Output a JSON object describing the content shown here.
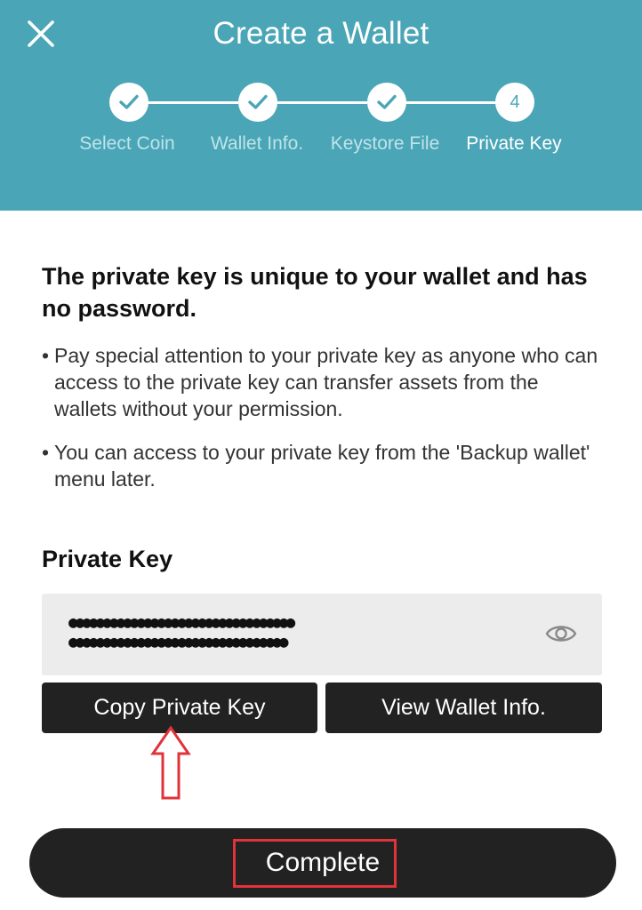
{
  "header": {
    "title": "Create a Wallet",
    "close_icon": "close-icon",
    "background": "#4aa6b6"
  },
  "steps": [
    {
      "label": "Select Coin",
      "state": "done",
      "marker": "check-icon"
    },
    {
      "label": "Wallet Info.",
      "state": "done",
      "marker": "check-icon"
    },
    {
      "label": "Keystore File",
      "state": "done",
      "marker": "check-icon"
    },
    {
      "label": "Private Key",
      "state": "current",
      "marker": "4"
    }
  ],
  "main": {
    "headline": "The private key is unique to your wallet and has no password.",
    "bullets": [
      "Pay special attention to your private key as anyone who can access to the private key can transfer assets from the wallets without your permission.",
      "You can access to your private key from the 'Backup wallet' menu later."
    ]
  },
  "private_key": {
    "label": "Private Key",
    "masked_line_1": "●●●●●●●●●●●●●●●●●●●●●●●●●●●●●●●●●",
    "masked_line_2": "●●●●●●●●●●●●●●●●●●●●●●●●●●●●●●●●",
    "reveal_icon": "eye-icon"
  },
  "actions": {
    "copy_label": "Copy Private Key",
    "view_label": "View Wallet Info.",
    "complete_label": "Complete"
  },
  "annotations": {
    "arrow_color": "#e0333a",
    "box_color": "#e0333a"
  }
}
